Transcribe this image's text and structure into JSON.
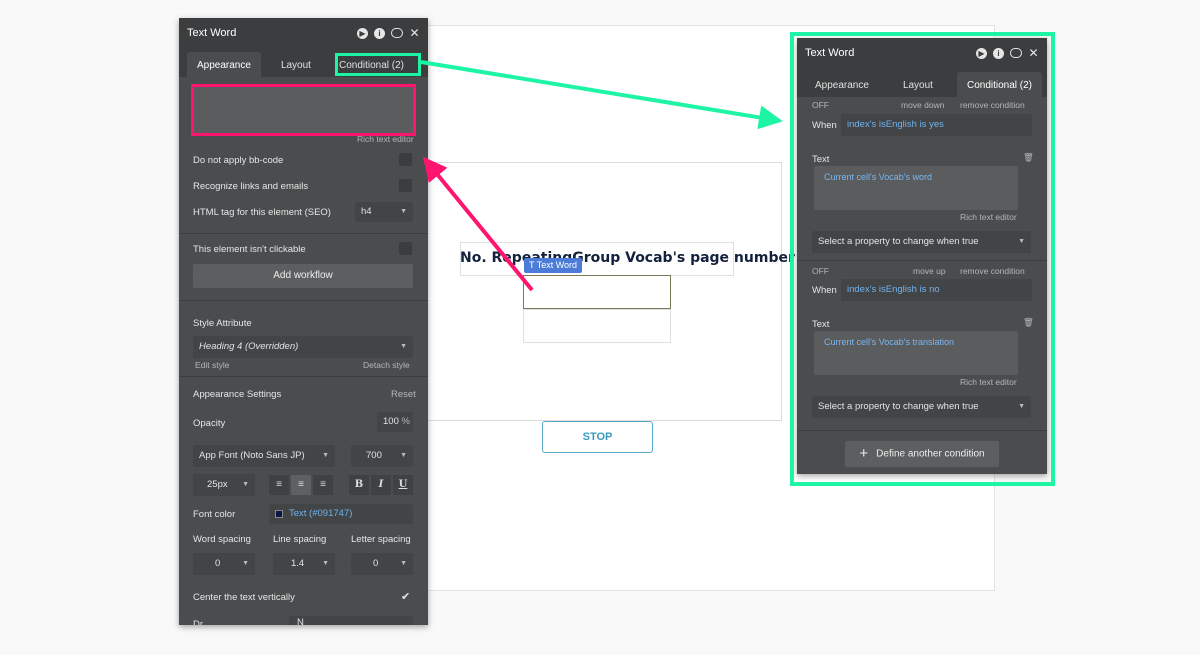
{
  "canvas": {
    "heading": "No. RepeatingGroup Vocab's page number",
    "tag_label": "Text Word",
    "stop_label": "STOP"
  },
  "left_panel": {
    "title": "Text Word",
    "tabs": [
      "Appearance",
      "Layout",
      "Conditional (2)"
    ],
    "rich_text_editor": "Rich text editor",
    "do_not_apply_bbcode": "Do not apply bb-code",
    "recognize_links": "Recognize links and emails",
    "html_tag_label": "HTML tag for this element (SEO)",
    "html_tag_value": "h4",
    "not_clickable": "This element isn't clickable",
    "add_workflow": "Add workflow",
    "style_attribute": "Style Attribute",
    "style_value": "Heading 4 (Overridden)",
    "edit_style": "Edit style",
    "detach_style": "Detach style",
    "appearance_settings": "Appearance Settings",
    "reset": "Reset",
    "opacity_label": "Opacity",
    "opacity_value": "100",
    "opacity_unit": "%",
    "font_value": "App Font (Noto Sans JP)",
    "weight_value": "700",
    "size_value": "25px",
    "bold": "B",
    "italic": "I",
    "underline": "U",
    "font_color_label": "Font color",
    "font_color_value": "Text (#091747)",
    "word_spacing_label": "Word spacing",
    "line_spacing_label": "Line spacing",
    "letter_spacing_label": "Letter spacing",
    "word_spacing_value": "0",
    "line_spacing_value": "1.4",
    "letter_spacing_value": "0",
    "center_vertically": "Center the text vertically",
    "bottom_partial_1": "Dr",
    "bottom_partial_2": "N"
  },
  "right_panel": {
    "title": "Text Word",
    "tabs": [
      "Appearance",
      "Layout",
      "Conditional (2)"
    ],
    "conditions": [
      {
        "off": "OFF",
        "move": "move down",
        "remove": "remove condition",
        "when_label": "When",
        "when_value": "index's isEnglish is yes",
        "text_label": "Text",
        "text_value": "Current cell's Vocab's word",
        "rich_text_editor": "Rich text editor",
        "select_property": "Select a property to change when true"
      },
      {
        "off": "OFF",
        "move": "move up",
        "remove": "remove condition",
        "when_label": "When",
        "when_value": "index's isEnglish is no",
        "text_label": "Text",
        "text_value": "Current cell's Vocab's translation",
        "rich_text_editor": "Rich text editor",
        "select_property": "Select a property to change when true"
      }
    ],
    "define_another": "Define another condition"
  },
  "colors": {
    "highlight_pink": "#ff1470",
    "highlight_green": "#1ef5a4",
    "panel_bg": "#4a4c4e",
    "text_color_swatch": "#091747"
  }
}
